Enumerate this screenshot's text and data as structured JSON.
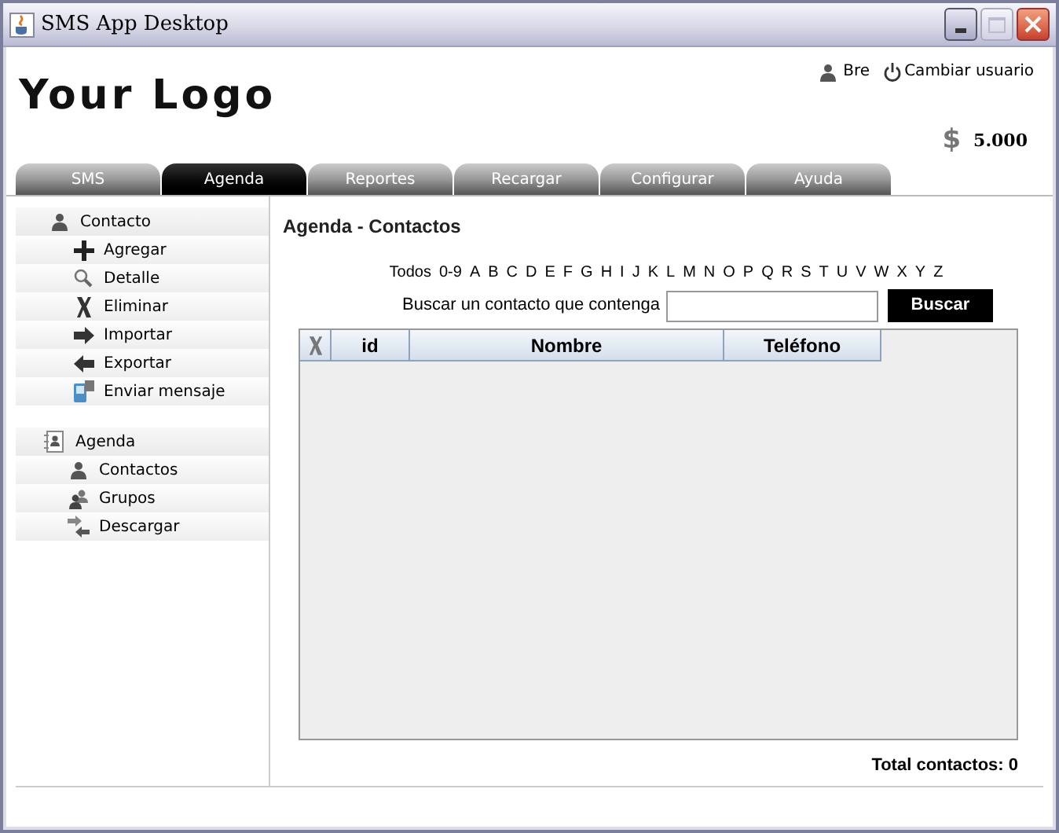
{
  "window": {
    "title": "SMS App Desktop"
  },
  "header": {
    "logo": "Your Logo",
    "user": "Bre",
    "switch_user": "Cambiar usuario",
    "currency_symbol": "$",
    "balance": "5.000"
  },
  "tabs": [
    {
      "label": "SMS",
      "selected": false
    },
    {
      "label": "Agenda",
      "selected": true
    },
    {
      "label": "Reportes",
      "selected": false
    },
    {
      "label": "Recargar",
      "selected": false
    },
    {
      "label": "Configurar",
      "selected": false
    },
    {
      "label": "Ayuda",
      "selected": false
    }
  ],
  "sidebar": {
    "groups": [
      {
        "label": "Contacto",
        "kind": "person",
        "children": [
          {
            "label": "Agregar",
            "kind": "plus"
          },
          {
            "label": "Detalle",
            "kind": "search"
          },
          {
            "label": "Eliminar",
            "kind": "x"
          },
          {
            "label": "Importar",
            "kind": "right"
          },
          {
            "label": "Exportar",
            "kind": "left"
          },
          {
            "label": "Enviar mensaje",
            "kind": "phone"
          }
        ]
      },
      {
        "label": "Agenda",
        "kind": "book",
        "children": [
          {
            "label": "Contactos",
            "kind": "person"
          },
          {
            "label": "Grupos",
            "kind": "people"
          },
          {
            "label": "Descargar",
            "kind": "swap"
          }
        ]
      }
    ]
  },
  "main": {
    "title": "Agenda - Contactos",
    "letters": [
      "Todos",
      "0-9",
      "A",
      "B",
      "C",
      "D",
      "E",
      "F",
      "G",
      "H",
      "I",
      "J",
      "K",
      "L",
      "M",
      "N",
      "O",
      "P",
      "Q",
      "R",
      "S",
      "T",
      "U",
      "V",
      "W",
      "X",
      "Y",
      "Z"
    ],
    "search_label": "Buscar un contacto que contenga",
    "search_button": "Buscar",
    "table": {
      "columns": [
        {
          "kind": "delete"
        },
        {
          "kind": "text",
          "label": "id"
        },
        {
          "kind": "text",
          "label": "Nombre"
        },
        {
          "kind": "text",
          "label": "Teléfono"
        }
      ]
    },
    "total": "Total contactos: 0"
  }
}
